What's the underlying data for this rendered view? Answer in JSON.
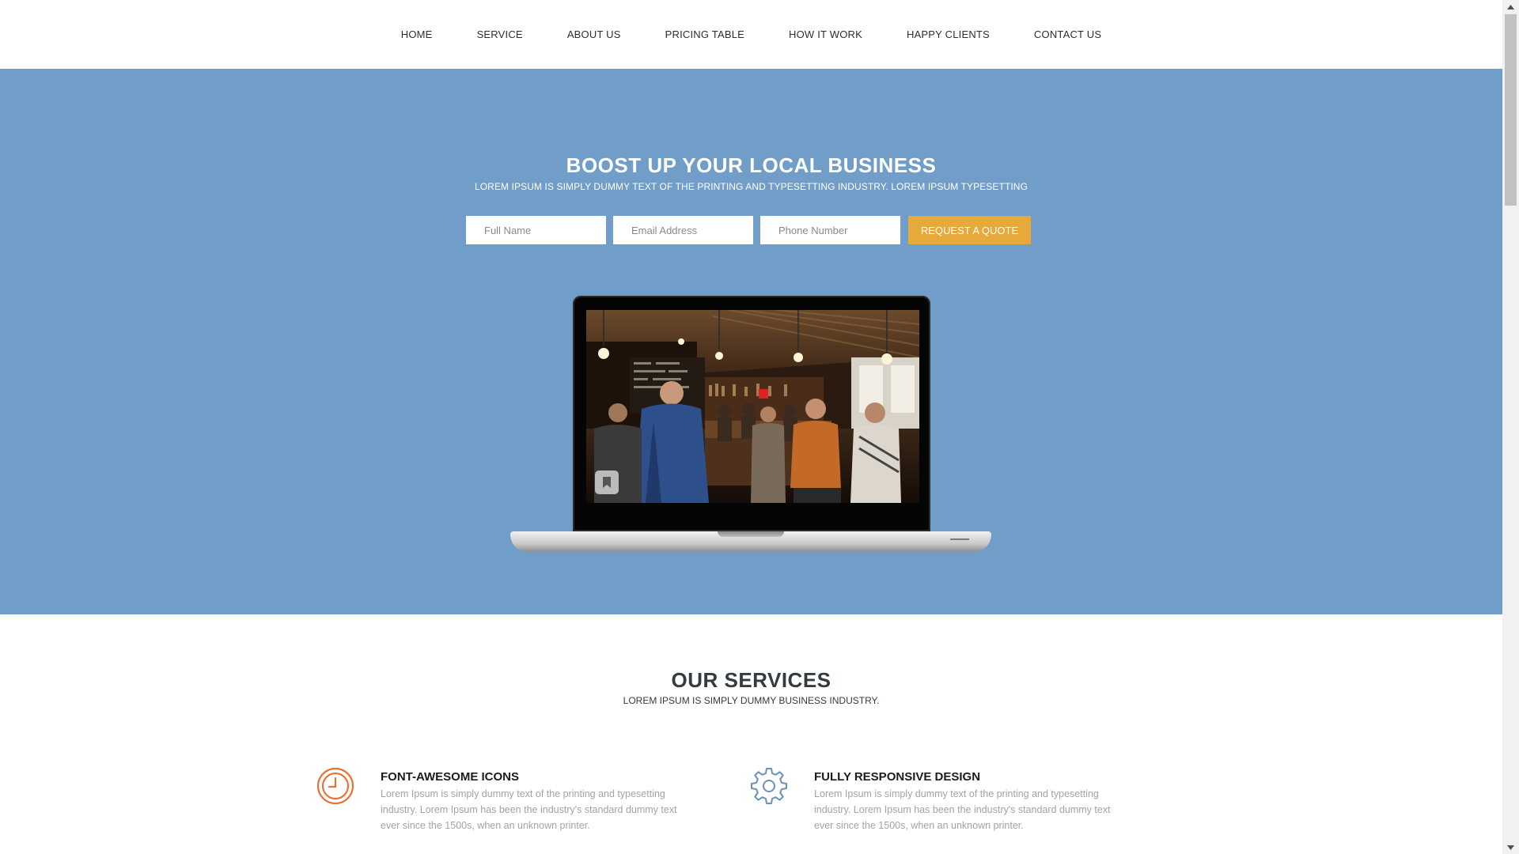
{
  "nav": {
    "items": [
      {
        "label": "HOME"
      },
      {
        "label": "SERVICE"
      },
      {
        "label": "ABOUT US"
      },
      {
        "label": "PRICING TABLE"
      },
      {
        "label": "HOW IT WORK"
      },
      {
        "label": "HAPPY CLIENTS"
      },
      {
        "label": "CONTACT US"
      }
    ]
  },
  "hero": {
    "title": "BOOST UP YOUR LOCAL BUSINESS",
    "subtitle": "LOREM IPSUM IS SIMPLY DUMMY TEXT OF THE PRINTING AND TYPESETTING INDUSTRY. LOREM IPSUM TYPESETTING",
    "form": {
      "full_name_placeholder": "Full Name",
      "email_placeholder": "Email Address",
      "phone_placeholder": "Phone Number",
      "submit_label": "REQUEST A QUOTE"
    },
    "bg_color": "#719dc9",
    "accent_color": "#e6a93a"
  },
  "services": {
    "title": "OUR SERVICES",
    "subtitle": "LOREM IPSUM IS SIMPLY DUMMY BUSINESS INDUSTRY.",
    "items": [
      {
        "icon": "clock-icon",
        "icon_color": "#e8743b",
        "title": "FONT-AWESOME ICONS",
        "text": "Lorem Ipsum is simply dummy text of the printing and typesetting industry. Lorem Ipsum has been the industry's standard dummy text ever since the 1500s, when an unknown printer."
      },
      {
        "icon": "gear-icon",
        "icon_color": "#6d91b5",
        "title": "FULLY RESPONSIVE DESIGN",
        "text": "Lorem Ipsum is simply dummy text of the printing and typesetting industry. Lorem Ipsum has been the industry's standard dummy text ever since the 1500s, when an unknown printer."
      }
    ]
  }
}
